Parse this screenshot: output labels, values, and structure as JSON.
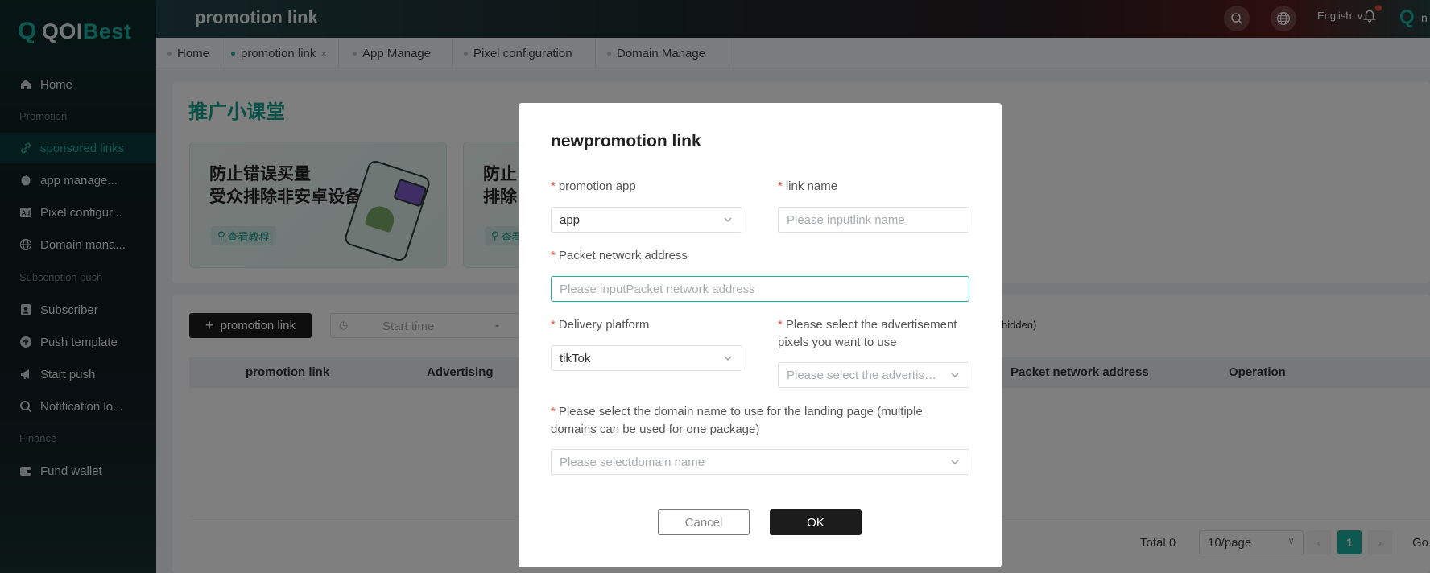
{
  "app": {
    "logo_text_1": "QOI",
    "logo_text_2": "Best"
  },
  "sidebar": {
    "home": "Home",
    "sections": {
      "promotion": "Promotion",
      "subscription": "Subscription push",
      "finance": "Finance"
    },
    "items": [
      {
        "label": "sponsored links",
        "icon": "link-icon"
      },
      {
        "label": "app manage...",
        "icon": "apple-icon"
      },
      {
        "label": "Pixel configur...",
        "icon": "ad-icon"
      },
      {
        "label": "Domain mana...",
        "icon": "globe-icon"
      },
      {
        "label": "Subscriber",
        "icon": "subscriber-icon"
      },
      {
        "label": "Push template",
        "icon": "upload-icon"
      },
      {
        "label": "Start push",
        "icon": "megaphone-icon"
      },
      {
        "label": "Notification lo...",
        "icon": "search-icon"
      },
      {
        "label": "Fund wallet",
        "icon": "wallet-icon"
      }
    ]
  },
  "topbar": {
    "title": "promotion link",
    "language": "English",
    "user_initial": "n"
  },
  "tabs": [
    "Home",
    "promotion link",
    "App Manage",
    "Pixel configuration",
    "Domain Manage"
  ],
  "classroom": {
    "title": "推广小课堂",
    "cards": [
      {
        "line1": "防止错误买量",
        "line2": "受众排除非安卓设备",
        "tag": "查看教程"
      },
      {
        "line1": "防止",
        "line2": "排除",
        "tag": "查看"
      }
    ]
  },
  "list": {
    "add_button": "promotion link",
    "start_time_placeholder": "Start time",
    "date_separator": "-",
    "hidden_note": "hidden)",
    "columns": [
      "promotion link",
      "Advertising",
      "Packet network address",
      "Operation"
    ],
    "total": "Total 0",
    "page_size": "10/page",
    "current_page": "1",
    "goto": "Go"
  },
  "modal": {
    "title": "newpromotion link",
    "promotion_app_label": "promotion app",
    "promotion_app_value": "app",
    "link_name_label": "link name",
    "link_name_placeholder": "Please inputlink name",
    "packet_label": "Packet network address",
    "packet_placeholder": "Please inputPacket network address",
    "delivery_label": "Delivery platform",
    "delivery_value": "tikTok",
    "pixels_label": "Please select the advertisement pixels you want to use",
    "pixels_placeholder": "Please select the advertise...",
    "domain_label": "Please select the domain name to use for the landing page (multiple domains can be used for one package)",
    "domain_placeholder": "Please selectdomain name",
    "required_mark": "*",
    "cancel": "Cancel",
    "ok": "OK"
  },
  "colors": {
    "accent": "#1ab2a3",
    "dark_button": "#1c1c1c",
    "required": "#e0533b"
  }
}
